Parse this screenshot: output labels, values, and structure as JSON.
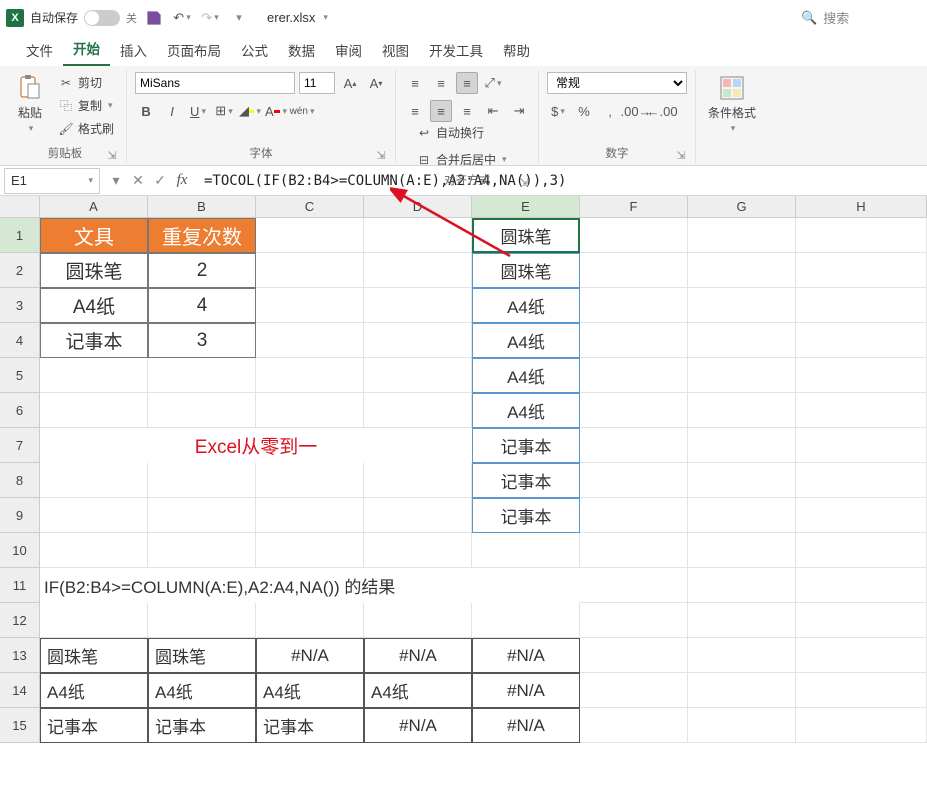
{
  "title_bar": {
    "autosave_label": "自动保存",
    "autosave_state": "关",
    "file_name": "erer.xlsx",
    "search_placeholder": "搜索"
  },
  "tabs": {
    "file": "文件",
    "home": "开始",
    "insert": "插入",
    "page_layout": "页面布局",
    "formulas": "公式",
    "data": "数据",
    "review": "审阅",
    "view": "视图",
    "developer": "开发工具",
    "help": "帮助"
  },
  "ribbon": {
    "clipboard": {
      "paste": "粘贴",
      "cut": "剪切",
      "copy": "复制",
      "format_painter": "格式刷",
      "group": "剪贴板"
    },
    "font": {
      "name": "MiSans",
      "size": "11",
      "group": "字体"
    },
    "alignment": {
      "wrap": "自动换行",
      "merge": "合并后居中",
      "group": "对齐方式"
    },
    "number": {
      "format": "常规",
      "group": "数字"
    },
    "styles": {
      "conditional": "条件格式"
    }
  },
  "formula_bar": {
    "name_box": "E1",
    "formula": "=TOCOL(IF(B2:B4>=COLUMN(A:E),A2:A4,NA()),3)"
  },
  "columns": [
    "A",
    "B",
    "C",
    "D",
    "E",
    "F",
    "G",
    "H"
  ],
  "row_numbers": [
    "1",
    "2",
    "3",
    "4",
    "5",
    "6",
    "7",
    "8",
    "9",
    "10",
    "11",
    "12",
    "13",
    "14",
    "15"
  ],
  "chart_data": {
    "type": "table",
    "input_table": {
      "headers": [
        "文具",
        "重复次数"
      ],
      "rows": [
        [
          "圆珠笔",
          "2"
        ],
        [
          "A4纸",
          "4"
        ],
        [
          "记事本",
          "3"
        ]
      ]
    },
    "tocol_result": [
      "圆珠笔",
      "圆珠笔",
      "A4纸",
      "A4纸",
      "A4纸",
      "A4纸",
      "记事本",
      "记事本",
      "记事本"
    ],
    "watermark": "Excel从零到一",
    "if_result_caption": "IF(B2:B4>=COLUMN(A:E),A2:A4,NA())   的结果",
    "if_result_table": [
      [
        "圆珠笔",
        "圆珠笔",
        "#N/A",
        "#N/A",
        "#N/A"
      ],
      [
        "A4纸",
        "A4纸",
        "A4纸",
        "A4纸",
        "#N/A"
      ],
      [
        "记事本",
        "记事本",
        "记事本",
        "#N/A",
        "#N/A"
      ]
    ]
  }
}
